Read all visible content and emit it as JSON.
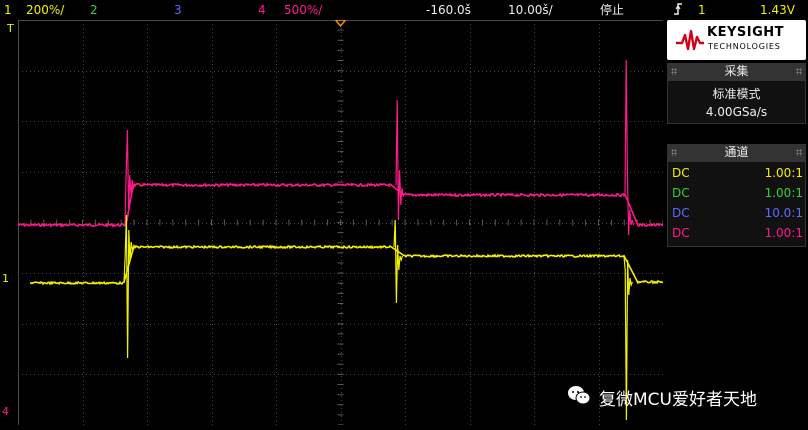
{
  "topbar": {
    "ch1_num": "1",
    "ch1_scale": "200%/",
    "ch2_num": "2",
    "ch3_num": "3",
    "ch4_num": "4",
    "ch4_scale": "500%/",
    "time_offset": "-160.0š",
    "time_scale": "10.00š/",
    "run_state": "停止",
    "trigger_icon": "trigger-edge-icon",
    "trigger_source": "1",
    "trigger_level": "1.43V"
  },
  "colors": {
    "ch1": "#f2f200",
    "ch2": "#32d232",
    "ch3": "#5a6cff",
    "ch4": "#ff1a8c",
    "grid": "#4a4a4a",
    "trigger_marker": "#ff8c00"
  },
  "logo": {
    "brand": "KEYSIGHT",
    "sub": "TECHNOLOGIES"
  },
  "acquire": {
    "title": "采集",
    "mode": "标准模式",
    "rate": "4.00GSa/s"
  },
  "channels": {
    "title": "通道",
    "rows": [
      {
        "coupling": "DC",
        "ratio": "1.00:1",
        "color": "#f2f200"
      },
      {
        "coupling": "DC",
        "ratio": "1.00:1",
        "color": "#32d232"
      },
      {
        "coupling": "DC",
        "ratio": "10.0:1",
        "color": "#5a6cff"
      },
      {
        "coupling": "DC",
        "ratio": "1.00:1",
        "color": "#ff1a8c"
      }
    ]
  },
  "markers": {
    "ch1_ground": "1",
    "ch4_ground": "4",
    "trigger_level_mark": "T"
  },
  "watermark": {
    "text": "复微MCU爱好者天地",
    "icon": "wechat-icon"
  }
}
